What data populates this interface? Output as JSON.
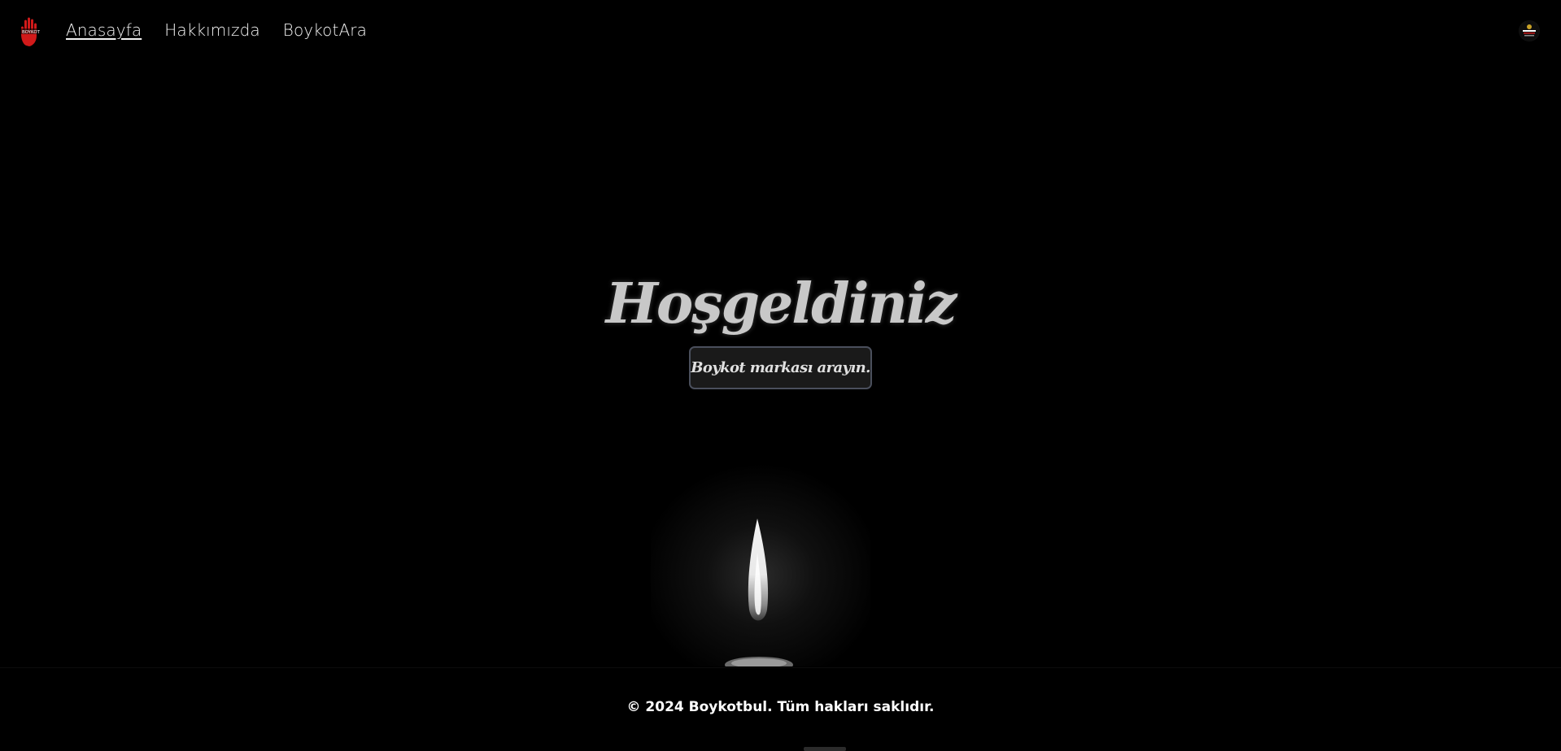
{
  "brand": {
    "logo_icon": "red-hand-boycott-icon",
    "logo_text": "BOYKOT",
    "accent_color": "#d11a1a"
  },
  "nav": {
    "items": [
      {
        "label": "Anasayfa",
        "active": true
      },
      {
        "label": "Hakkımızda",
        "active": false
      },
      {
        "label": "BoykotAra",
        "active": false
      }
    ]
  },
  "corner_badge": {
    "icon": "emblem-badge-icon"
  },
  "hero": {
    "title": "Hoşgeldiniz",
    "cta_label": "Boykot markası arayın."
  },
  "candle": {
    "icon": "candle-flame-icon"
  },
  "footer": {
    "text": "© 2024 Boykotbul. Tüm hakları saklıdır."
  }
}
